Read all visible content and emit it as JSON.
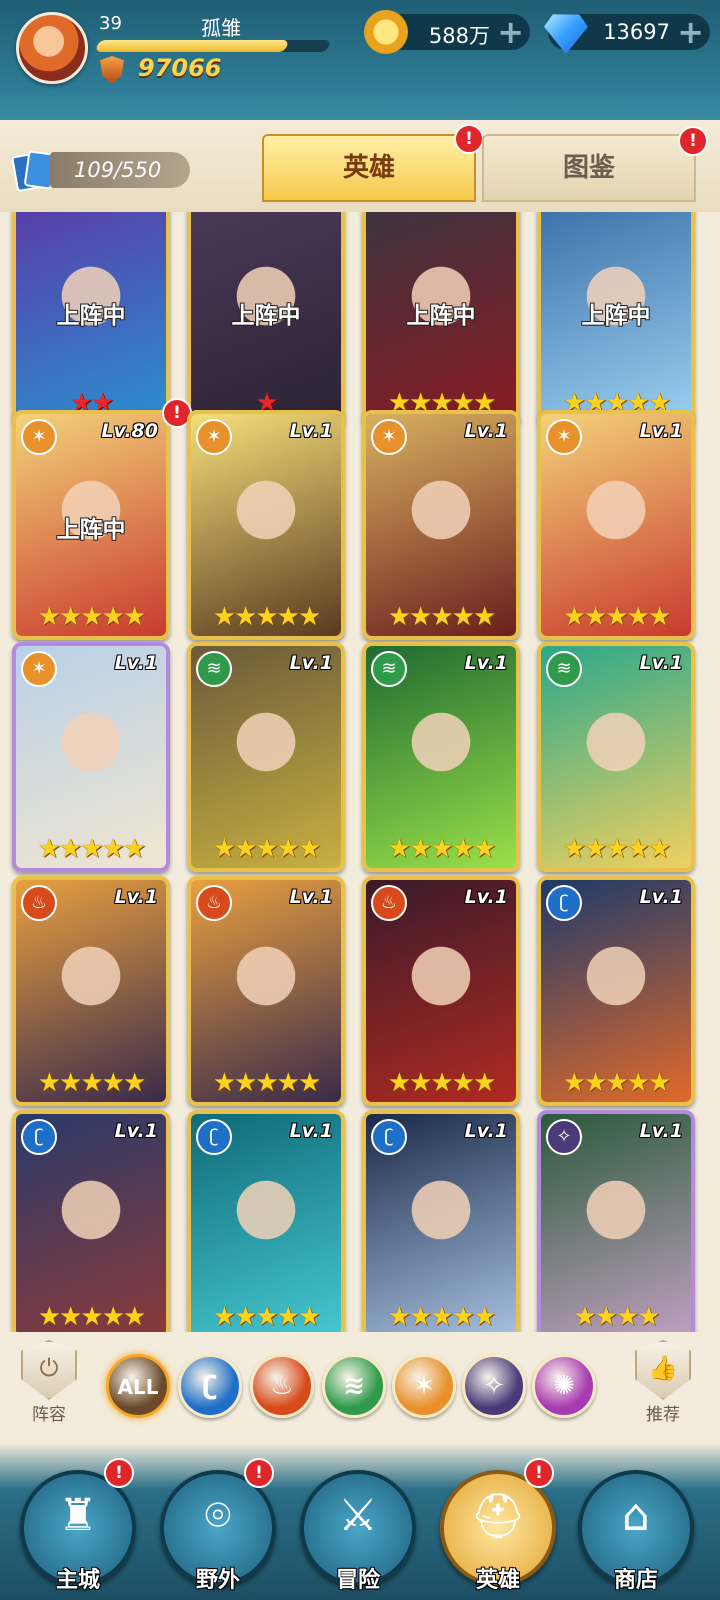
{
  "player": {
    "level": "39",
    "name": "孤雏",
    "xp_fraction": 0.82,
    "power": "97066"
  },
  "resources": {
    "gold": "588万",
    "gems": "13697"
  },
  "roster": {
    "count": "109/550"
  },
  "tabs": [
    {
      "label": "英雄",
      "active": true,
      "alert": "!"
    },
    {
      "label": "图鉴",
      "active": false,
      "alert": "!"
    }
  ],
  "heroes": [
    {
      "level": "",
      "status": "上阵中",
      "stars": 2,
      "star_color": "red",
      "faction": "",
      "colors": [
        "#5a3aa8",
        "#2b8fd0"
      ]
    },
    {
      "level": "",
      "status": "上阵中",
      "stars": 1,
      "star_color": "red",
      "faction": "",
      "colors": [
        "#4a3a5a",
        "#2d2233"
      ]
    },
    {
      "level": "",
      "status": "上阵中",
      "stars": 5,
      "star_color": "gold",
      "faction": "",
      "colors": [
        "#3a3540",
        "#8a1a22"
      ]
    },
    {
      "level": "",
      "status": "上阵中",
      "stars": 5,
      "star_color": "gold",
      "faction": "",
      "colors": [
        "#3a6fa8",
        "#9ad0f0"
      ]
    },
    {
      "level": "Lv.80",
      "status": "上阵中",
      "stars": 5,
      "star_color": "gold",
      "faction": "light",
      "colors": [
        "#f3d27a",
        "#c93a2e"
      ],
      "alert": "!"
    },
    {
      "level": "Lv.1",
      "status": "",
      "stars": 5,
      "star_color": "gold",
      "faction": "light",
      "colors": [
        "#f5df7a",
        "#5a3a20"
      ]
    },
    {
      "level": "Lv.1",
      "status": "",
      "stars": 5,
      "star_color": "gold",
      "faction": "light",
      "colors": [
        "#d8b060",
        "#6a1e1e"
      ]
    },
    {
      "level": "Lv.1",
      "status": "",
      "stars": 5,
      "star_color": "gold",
      "faction": "light",
      "colors": [
        "#f3d27a",
        "#c93a2e"
      ]
    },
    {
      "level": "Lv.1",
      "status": "",
      "stars": 5,
      "star_color": "gold",
      "faction": "light",
      "colors": [
        "#b9d0e8",
        "#f0e6d0"
      ],
      "purple": true
    },
    {
      "level": "Lv.1",
      "status": "",
      "stars": 5,
      "star_color": "gold",
      "faction": "nature",
      "colors": [
        "#6a5a3a",
        "#c8b040"
      ]
    },
    {
      "level": "Lv.1",
      "status": "",
      "stars": 5,
      "star_color": "gold",
      "faction": "nature",
      "colors": [
        "#1f6a30",
        "#9ae04a"
      ]
    },
    {
      "level": "Lv.1",
      "status": "",
      "stars": 5,
      "star_color": "gold",
      "faction": "nature",
      "colors": [
        "#2aa88a",
        "#f0d060"
      ]
    },
    {
      "level": "Lv.1",
      "status": "",
      "stars": 5,
      "star_color": "gold",
      "faction": "fire",
      "colors": [
        "#e8a040",
        "#3a2a4a"
      ]
    },
    {
      "level": "Lv.1",
      "status": "",
      "stars": 5,
      "star_color": "gold",
      "faction": "fire",
      "colors": [
        "#e8a040",
        "#3a2a4a"
      ]
    },
    {
      "level": "Lv.1",
      "status": "",
      "stars": 5,
      "star_color": "gold",
      "faction": "fire",
      "colors": [
        "#3a1a2a",
        "#b02a20"
      ]
    },
    {
      "level": "Lv.1",
      "status": "",
      "stars": 5,
      "star_color": "gold",
      "faction": "water",
      "colors": [
        "#1e3a6a",
        "#e06a2a"
      ]
    },
    {
      "level": "Lv.1",
      "status": "",
      "stars": 5,
      "star_color": "gold",
      "faction": "water",
      "colors": [
        "#2a3a6a",
        "#8a3a3a"
      ]
    },
    {
      "level": "Lv.1",
      "status": "",
      "stars": 5,
      "star_color": "gold",
      "faction": "water",
      "colors": [
        "#0f6a78",
        "#46c8d0"
      ]
    },
    {
      "level": "Lv.1",
      "status": "",
      "stars": 5,
      "star_color": "gold",
      "faction": "water",
      "colors": [
        "#1a2a48",
        "#a8c0e0"
      ]
    },
    {
      "level": "Lv.1",
      "status": "",
      "stars": 4,
      "star_color": "gold",
      "faction": "dark",
      "colors": [
        "#2a5a3a",
        "#c0a0c0"
      ],
      "purple": true
    }
  ],
  "factions": {
    "light": {
      "glyph": "✶",
      "color": "#e8902a"
    },
    "nature": {
      "glyph": "≋",
      "color": "#2f9a4a"
    },
    "fire": {
      "glyph": "♨",
      "color": "#d84a1a"
    },
    "water": {
      "glyph": "ʗ",
      "color": "#1f6fc8"
    },
    "dark": {
      "glyph": "✧",
      "color": "#4a3a78"
    }
  },
  "filters": [
    {
      "label": "ALL",
      "icon": "all-icon",
      "color": "#6a4a2a",
      "selected": true
    },
    {
      "label": "ʗ",
      "icon": "water-faction-icon",
      "color": "#1f6fc8"
    },
    {
      "label": "♨",
      "icon": "fire-faction-icon",
      "color": "#d84a1a"
    },
    {
      "label": "≋",
      "icon": "nature-faction-icon",
      "color": "#2f9a4a"
    },
    {
      "label": "✶",
      "icon": "light-faction-icon",
      "color": "#e8902a"
    },
    {
      "label": "✧",
      "icon": "dark-faction-icon",
      "color": "#4a3a78"
    },
    {
      "label": "✺",
      "icon": "void-faction-icon",
      "color": "#a83ab0"
    }
  ],
  "side_buttons": {
    "lineup": "阵容",
    "recommend": "推荐"
  },
  "nav": [
    {
      "label": "主城",
      "icon": "castle-icon",
      "glyph": "♜",
      "alert": "!"
    },
    {
      "label": "野外",
      "icon": "portal-icon",
      "glyph": "⌾",
      "alert": "!"
    },
    {
      "label": "冒险",
      "icon": "sword-icon",
      "glyph": "⚔"
    },
    {
      "label": "英雄",
      "icon": "helmet-icon",
      "glyph": "⛑",
      "alert": "!",
      "active": true
    },
    {
      "label": "商店",
      "icon": "shop-icon",
      "glyph": "⌂"
    }
  ]
}
